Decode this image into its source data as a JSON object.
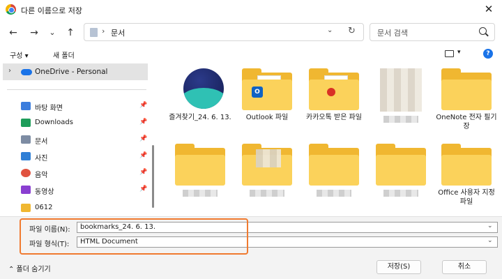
{
  "window": {
    "title": "다른 이름으로 저장",
    "close": "✕"
  },
  "nav_buttons": {
    "back": "←",
    "forward": "→",
    "recent": "⌄",
    "up": "↑"
  },
  "address": {
    "separator": "›",
    "path": "문서",
    "dropdown": "⌄",
    "refresh": "↻"
  },
  "search": {
    "placeholder": "문서 검색"
  },
  "command_bar": {
    "organize": "구성 ▾",
    "new_folder": "새 폴더",
    "view_caret": "▾",
    "help": "?"
  },
  "sidebar": {
    "onedrive": {
      "chevron": "›",
      "label": "OneDrive - Personal"
    },
    "items": [
      {
        "label": "바탕 화면",
        "icon": "desktop-icon",
        "color": "#3b7ddd",
        "pinned": true
      },
      {
        "label": "Downloads",
        "icon": "download-icon",
        "color": "#1e9d5a",
        "pinned": true
      },
      {
        "label": "문서",
        "icon": "document-icon",
        "color": "#7d8ca3",
        "pinned": true
      },
      {
        "label": "사진",
        "icon": "pictures-icon",
        "color": "#2f7fd6",
        "pinned": true
      },
      {
        "label": "음악",
        "icon": "music-icon",
        "color": "#e0523f",
        "pinned": true
      },
      {
        "label": "동영상",
        "icon": "video-icon",
        "color": "#8a3fd1",
        "pinned": true
      },
      {
        "label": "0612",
        "icon": "folder-icon",
        "color": "#f0b731",
        "pinned": false
      }
    ],
    "pin_glyph": "📌"
  },
  "files": [
    {
      "label": "즐겨찾기_24. 6. 13.",
      "kind": "whale"
    },
    {
      "label": "Outlook 파일",
      "kind": "folder-outlook"
    },
    {
      "label": "카카오톡 받은 파일",
      "kind": "folder-kakao"
    },
    {
      "label": "",
      "kind": "blurred"
    },
    {
      "label": "OneNote 전자 필기장",
      "kind": "folder"
    },
    {
      "label": "",
      "kind": "folder-blurred"
    },
    {
      "label": "",
      "kind": "folder-blurred"
    },
    {
      "label": "",
      "kind": "folder-blurred"
    },
    {
      "label": "",
      "kind": "folder-blurred"
    },
    {
      "label": "Office 사용자 지정 파일",
      "kind": "folder-blurred-partial"
    }
  ],
  "form": {
    "filename_label": "파일 이름(N):",
    "filename_value": "bookmarks_24. 6. 13.",
    "filetype_label": "파일 형식(T):",
    "filetype_value": "HTML Document",
    "dropdown": "⌄"
  },
  "footer": {
    "hide_folders": "⌃  폴더 숨기기",
    "save": "저장(S)",
    "cancel": "취소"
  },
  "colors": {
    "accent": "#1a73e8",
    "highlight": "#f07a2f",
    "folder": "#f0b731"
  }
}
